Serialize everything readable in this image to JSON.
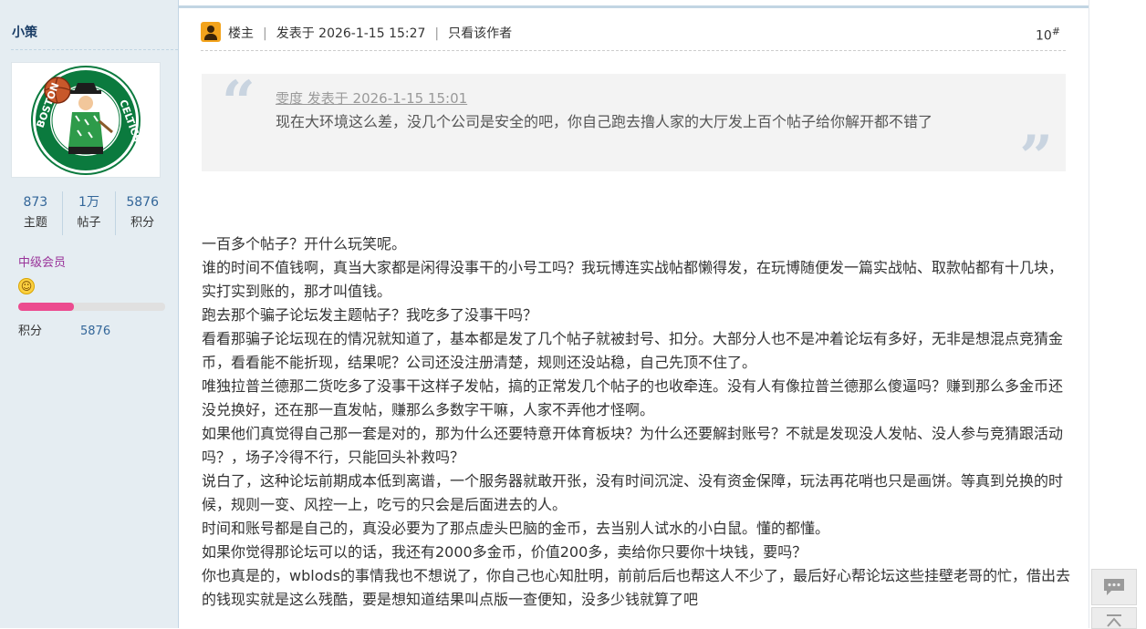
{
  "user": {
    "name": "小策",
    "stats": [
      {
        "value": "873",
        "label": "主题"
      },
      {
        "value": "1万",
        "label": "帖子"
      },
      {
        "value": "5876",
        "label": "积分"
      }
    ],
    "level": "中级会员",
    "level_progress_percent": 38,
    "credit_label": "积分",
    "credit_value": "5876"
  },
  "post": {
    "op_label": "楼主",
    "posted_at": "发表于 2026-1-15 15:27",
    "only_author": "只看该作者",
    "floor": "10",
    "floor_suffix": "#",
    "quote": {
      "author_line": "雯度 发表于 2026-1-15 15:01",
      "text": "现在大环境这么差，没几个公司是安全的吧，你自己跑去撸人家的大厅发上百个帖子给你解开都不错了"
    },
    "paragraphs": [
      "一百多个帖子？开什么玩笑呢。",
      "谁的时间不值钱啊，真当大家都是闲得没事干的小号工吗？我玩博连实战帖都懒得发，在玩博随便发一篇实战帖、取款帖都有十几块，实打实到账的，那才叫值钱。",
      "跑去那个骗子论坛发主题帖子？我吃多了没事干吗？",
      "看看那骗子论坛现在的情况就知道了，基本都是发了几个帖子就被封号、扣分。大部分人也不是冲着论坛有多好，无非是想混点竞猜金币，看看能不能折现，结果呢？公司还没注册清楚，规则还没站稳，自己先顶不住了。",
      "唯独拉普兰德那二货吃多了没事干这样子发帖，搞的正常发几个帖子的也收牵连。没有人有像拉普兰德那么傻逼吗？赚到那么多金币还没兑换好，还在那一直发帖，赚那么多数字干嘛，人家不弄他才怪啊。",
      "如果他们真觉得自己那一套是对的，那为什么还要特意开体育板块？为什么还要解封账号？不就是发现没人发帖、没人参与竞猜跟活动吗？，场子冷得不行，只能回头补救吗？",
      "说白了，这种论坛前期成本低到离谱，一个服务器就敢开张，没有时间沉淀、没有资金保障，玩法再花哨也只是画饼。等真到兑换的时候，规则一变、风控一上，吃亏的只会是后面进去的人。",
      "时间和账号都是自己的，真没必要为了那点虚头巴脑的金币，去当别人试水的小白鼠。懂的都懂。",
      "如果你觉得那论坛可以的话，我还有2000多金币，价值200多，卖给你只要你十块钱，要吗？",
      "你也真是的，wblods的事情我也不想说了，你自己也心知肚明，前前后后也帮这人不少了，最后好心帮论坛这些挂壁老哥的忙，借出去的钱现实就是这么残酷，要是想知道结果叫点版一查便知，没多少钱就算了吧"
    ]
  },
  "colors": {
    "sidebar_bg": "#e5edf2",
    "link_blue": "#336699",
    "member_purple": "#993399",
    "progress_pink": "#ec4b8f"
  }
}
